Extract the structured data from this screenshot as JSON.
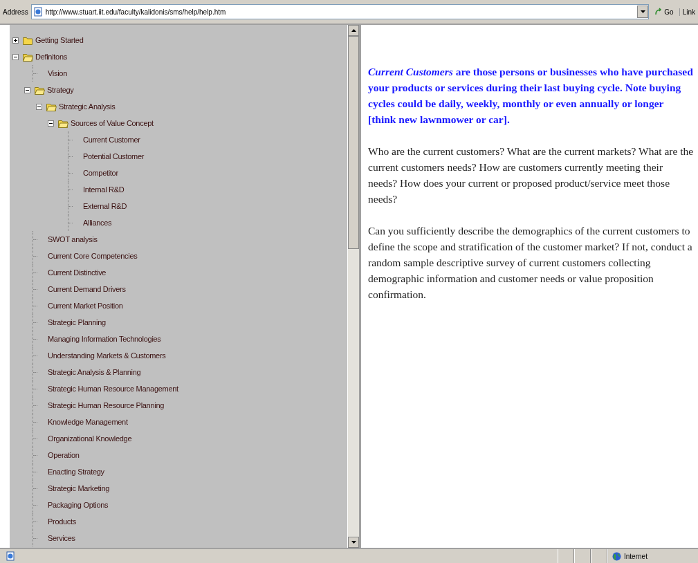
{
  "address_bar": {
    "label": "Address",
    "url": "http://www.stuart.iit.edu/faculty/kalidonis/sms/help/help.htm",
    "go_button": "Go",
    "links_label": "Link"
  },
  "tree": [
    {
      "label": "Getting Started",
      "kind": "folder",
      "expanded": false
    },
    {
      "label": "Definitons",
      "kind": "folder",
      "expanded": true,
      "children": [
        {
          "label": "Vision",
          "kind": "leaf"
        },
        {
          "label": "Strategy",
          "kind": "folder",
          "expanded": true,
          "children": [
            {
              "label": "Strategic Analysis",
              "kind": "folder",
              "expanded": true,
              "children": [
                {
                  "label": "Sources of Value Concept",
                  "kind": "folder",
                  "expanded": true,
                  "children": [
                    {
                      "label": "Current Customer",
                      "kind": "leaf"
                    },
                    {
                      "label": "Potential Customer",
                      "kind": "leaf"
                    },
                    {
                      "label": "Competitor",
                      "kind": "leaf"
                    },
                    {
                      "label": "Internal R&D",
                      "kind": "leaf"
                    },
                    {
                      "label": "External R&D",
                      "kind": "leaf"
                    },
                    {
                      "label": "Alliances",
                      "kind": "leaf"
                    }
                  ]
                }
              ]
            }
          ]
        },
        {
          "label": "SWOT analysis",
          "kind": "leaf"
        },
        {
          "label": "Current Core Competencies",
          "kind": "leaf"
        },
        {
          "label": "Current Distinctive",
          "kind": "leaf"
        },
        {
          "label": "Current Demand Drivers",
          "kind": "leaf"
        },
        {
          "label": "Current Market Position",
          "kind": "leaf"
        },
        {
          "label": "Strategic Planning",
          "kind": "leaf"
        },
        {
          "label": "Managing Information Technologies",
          "kind": "leaf"
        },
        {
          "label": "Understanding Markets & Customers",
          "kind": "leaf"
        },
        {
          "label": "Strategic Analysis & Planning",
          "kind": "leaf"
        },
        {
          "label": "Strategic Human Resource Management",
          "kind": "leaf"
        },
        {
          "label": "Strategic Human Resource Planning",
          "kind": "leaf"
        },
        {
          "label": "Knowledge Management",
          "kind": "leaf"
        },
        {
          "label": "Organizational Knowledge",
          "kind": "leaf"
        },
        {
          "label": "Operation",
          "kind": "leaf"
        },
        {
          "label": "Enacting Strategy",
          "kind": "leaf"
        },
        {
          "label": "Strategic Marketing",
          "kind": "leaf"
        },
        {
          "label": "Packaging Options",
          "kind": "leaf"
        },
        {
          "label": "Products",
          "kind": "leaf"
        },
        {
          "label": "Services",
          "kind": "leaf"
        }
      ]
    }
  ],
  "content": [
    {
      "kind": "definition",
      "text": "*Current Customers* are those persons or businesses who have purchased your products or services during their last buying cycle. Note buying cycles could be daily, weekly, monthly or even annually or longer [think new lawnmower or car]."
    },
    {
      "kind": "body",
      "text": "Who are the current customers? What are the current markets? What are the current customers needs?  How are customers currently meeting their needs? How does your current or proposed product/service meet those needs?"
    },
    {
      "kind": "body",
      "text": "Can you sufficiently describe  the demographics of the current  customers to define the scope and stratification of the customer market? If not, conduct a random sample descriptive survey of current customers collecting demographic information and customer needs or value proposition confirmation."
    }
  ],
  "status_bar": {
    "zone": "Internet"
  }
}
